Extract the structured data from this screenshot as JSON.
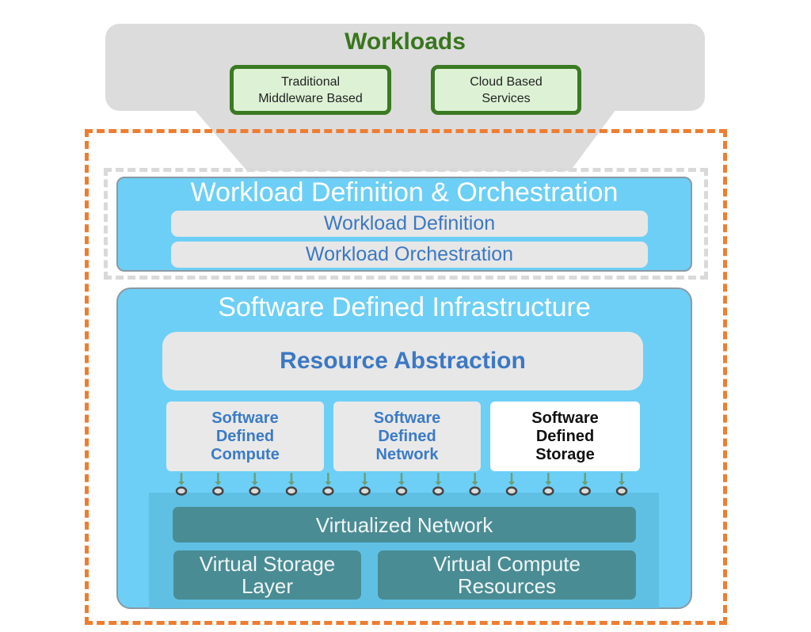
{
  "colors": {
    "workloads_green": "#38761d",
    "workload_item_fill": "#ddf2d5",
    "orange_boundary": "#ee7d31",
    "gray_boundary": "#d9d9d9",
    "panel_blue": "#6dcff6",
    "label_blue": "#3c78c3",
    "teal_box": "#4a8c94",
    "connector_arrow": "#6a9f78",
    "connector_node": "#444444"
  },
  "workloads": {
    "title": "Workloads",
    "items": [
      {
        "label_line1": "Traditional",
        "label_line2": "Middleware Based"
      },
      {
        "label_line1": "Cloud Based",
        "label_line2": "Services"
      }
    ]
  },
  "orchestration_layer": {
    "title": "Workload Definition & Orchestration",
    "rows": [
      "Workload Definition",
      "Workload Orchestration"
    ]
  },
  "sdi_layer": {
    "title": "Software Defined Infrastructure",
    "resource_abstraction": "Resource Abstraction",
    "components": [
      {
        "line1": "Software",
        "line2": "Defined",
        "line3": "Compute",
        "highlighted": false
      },
      {
        "line1": "Software",
        "line2": "Defined",
        "line3": "Network",
        "highlighted": false
      },
      {
        "line1": "Software",
        "line2": "Defined",
        "line3": "Storage",
        "highlighted": true
      }
    ],
    "connector_count": 13,
    "virtual_layer": {
      "network": "Virtualized Network",
      "storage": {
        "line1": "Virtual Storage",
        "line2": "Layer"
      },
      "compute": {
        "line1": "Virtual Compute",
        "line2": "Resources"
      }
    }
  }
}
